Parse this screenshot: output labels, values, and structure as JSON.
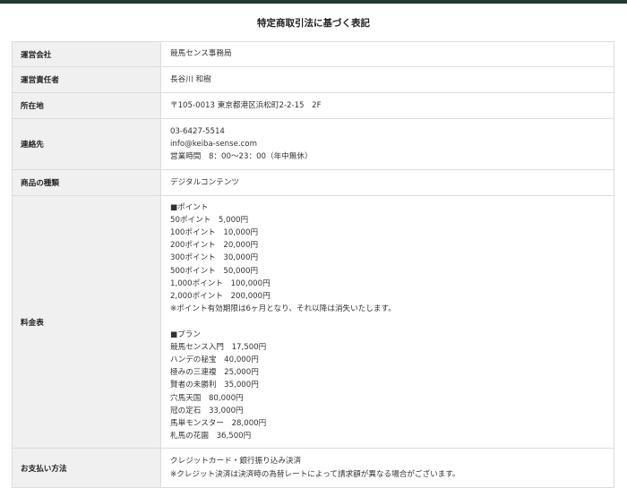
{
  "title": "特定商取引法に基づく表記",
  "rows": [
    {
      "label": "運営会社",
      "lines": [
        "競馬センス事務局"
      ]
    },
    {
      "label": "運営責任者",
      "lines": [
        "長谷川 和樹"
      ]
    },
    {
      "label": "所在地",
      "lines": [
        "〒105-0013 東京都港区浜松町2-2-15　2F"
      ]
    },
    {
      "label": "連絡先",
      "lines": [
        "03-6427-5514",
        "info@keiba-sense.com",
        "営業時間　8：00～23：00（年中無休）"
      ]
    },
    {
      "label": "商品の種類",
      "lines": [
        "デジタルコンテンツ"
      ]
    },
    {
      "label": "料金表",
      "points": [
        "■ポイント",
        "50ポイント　5,000円",
        "100ポイント　10,000円",
        "200ポイント　20,000円",
        "300ポイント　30,000円",
        "500ポイント　50,000円",
        "1,000ポイント　100,000円",
        "2,000ポイント　200,000円",
        "※ポイント有効期限は6ヶ月となり、それ以降は消失いたします。"
      ],
      "plans": [
        "■プラン",
        "競馬センス入門　17,500円",
        "ハンデの秘宝　40,000円",
        "極みの三連複　25,000円",
        "賢者の未勝利　35,000円",
        "穴馬天国　80,000円",
        "冠の定石　33,000円",
        "馬単モンスター　28,000円",
        "札馬の花園　36,500円"
      ]
    },
    {
      "label": "お支払い方法",
      "lines": [
        "クレジットカード・銀行振り込み決済",
        "※クレジット決済は決済時の為替レートによって請求額が異なる場合がございます。"
      ]
    }
  ]
}
